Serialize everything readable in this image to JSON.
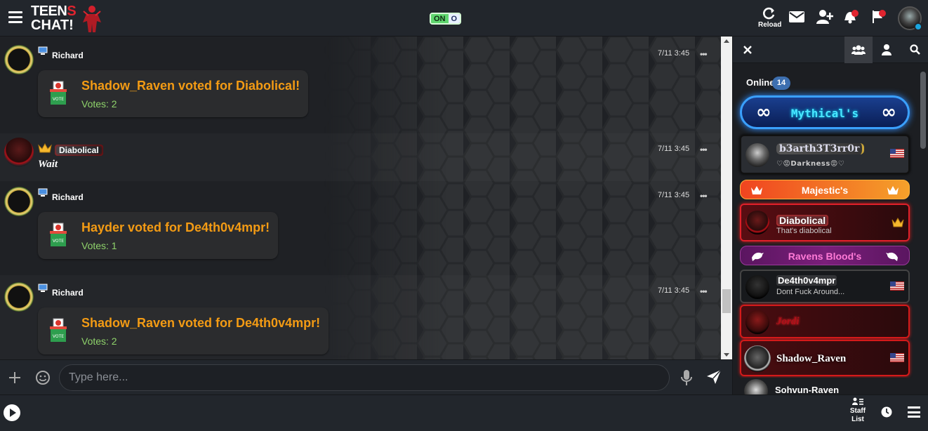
{
  "header": {
    "logo_line1_white": "TEEN",
    "logo_line1_red": "S",
    "logo_line2": "CHAT!",
    "toggle_on": "ON",
    "toggle_off": "O",
    "reload_label": "Reload"
  },
  "messages": [
    {
      "user": "Richard",
      "time": "7/11 3:45",
      "vote_text": "Shadow_Raven voted for Diabolical!",
      "votes": "Votes: 2"
    },
    {
      "user": "Diabolical",
      "time": "7/11 3:45",
      "text": "Wait"
    },
    {
      "user": "Richard",
      "time": "7/11 3:45",
      "vote_text": "Hayder voted for De4th0v4mpr!",
      "votes": "Votes: 1"
    },
    {
      "user": "Richard",
      "time": "7/11 3:45",
      "vote_text": "Shadow_Raven voted for De4th0v4mpr!",
      "votes": "Votes: 2"
    }
  ],
  "ballot_label": "VOTE",
  "dots_label": "•••",
  "input": {
    "placeholder": "Type here..."
  },
  "footer": {
    "staff_line1": "Staff",
    "staff_line2": "List"
  },
  "panel": {
    "online_label": "Online",
    "online_count": "14",
    "ranks": {
      "mythical": "Mythical's",
      "mythical_symbol": "∞",
      "majestic": "Majestic's",
      "ravens": "Ravens Blood's"
    },
    "users": [
      {
        "name": "b3arth3T3rr0r",
        "status": "♡😡Darkness😡♡"
      },
      {
        "name": "Diabolical",
        "status": "That's diabolical"
      },
      {
        "name": "De4th0v4mpr",
        "status": "Dont Fuck Around..."
      },
      {
        "name": "Jordi",
        "status": ""
      },
      {
        "name": "Shadow_Raven",
        "status": ""
      },
      {
        "name": "Sohvun-Raven",
        "status": ""
      }
    ]
  },
  "colors": {
    "vote_orange": "#f39b14",
    "votes_green": "#8fd36b",
    "mythical_blue": "#2f8cff",
    "majestic_orange": "#f5a12a",
    "ravens_purple": "#7a1f7a",
    "user_red": "#d41a1a"
  }
}
